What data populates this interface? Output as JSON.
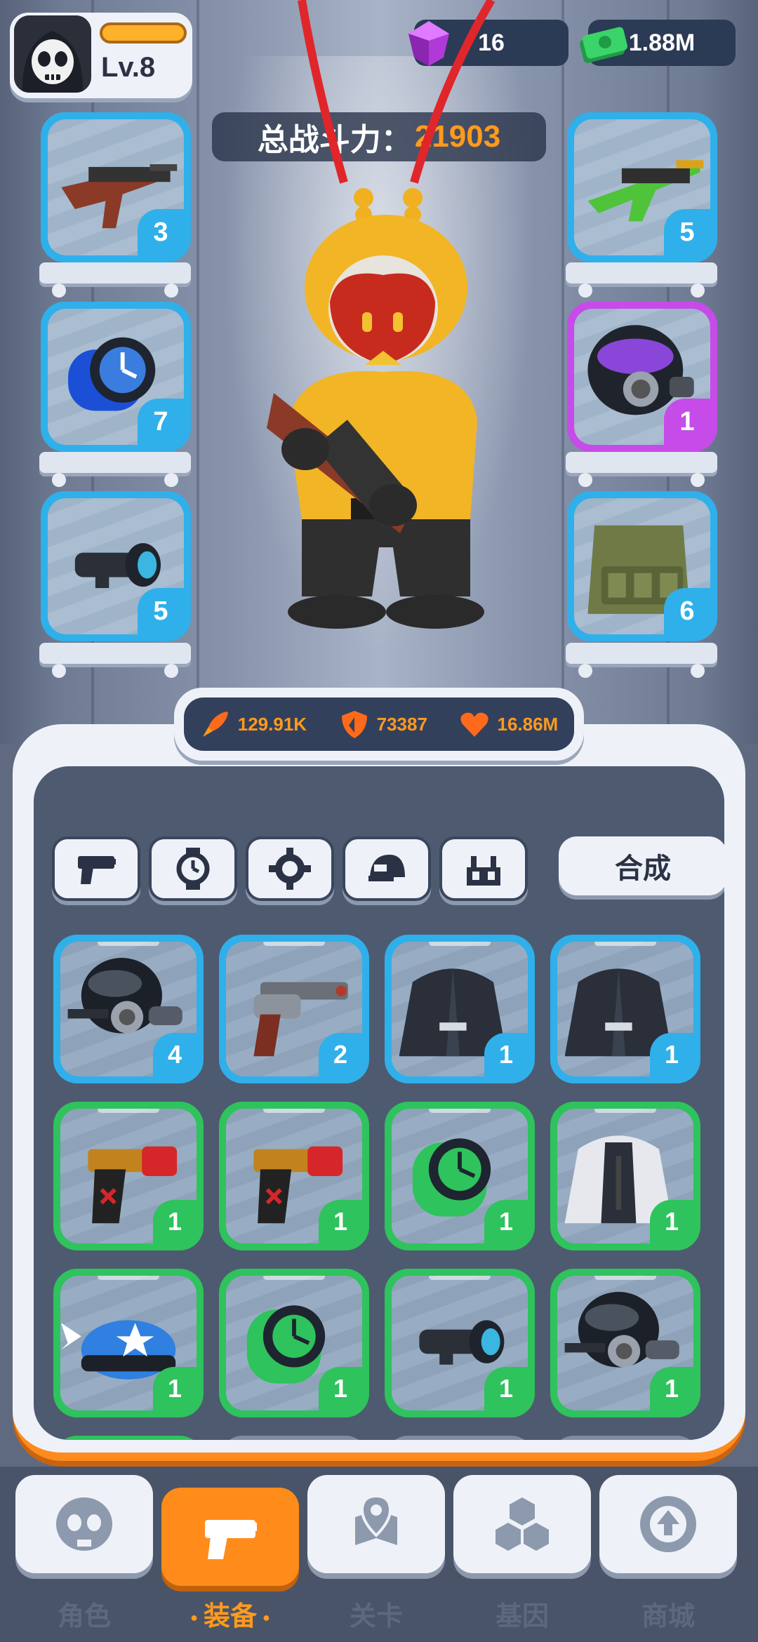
{
  "player": {
    "level": "Lv.8",
    "xp_progress": 1.0
  },
  "currency": {
    "gems": "16",
    "cash": "1.88M"
  },
  "power": {
    "label": "总战斗力：",
    "value": "21903"
  },
  "equipped": {
    "left": [
      {
        "icon": "assault-rifle-icon",
        "count": "3",
        "rarity": "blue"
      },
      {
        "icon": "blue-watch-icon",
        "count": "7",
        "rarity": "blue"
      },
      {
        "icon": "scope-icon",
        "count": "5",
        "rarity": "blue"
      }
    ],
    "right": [
      {
        "icon": "green-rifle-icon",
        "count": "5",
        "rarity": "blue"
      },
      {
        "icon": "gas-mask-helmet-icon",
        "count": "1",
        "rarity": "purple"
      },
      {
        "icon": "tactical-vest-icon",
        "count": "6",
        "rarity": "blue"
      }
    ]
  },
  "stats": {
    "attack": "129.91K",
    "defense": "73387",
    "health": "16.86M"
  },
  "categories": [
    "gun-icon",
    "watch-icon",
    "gear-icon",
    "helmet-icon",
    "armor-icon"
  ],
  "merge_label": "合成",
  "inventory": [
    {
      "icon": "gas-mask-icon",
      "count": "4",
      "rarity": "blue"
    },
    {
      "icon": "revolver-icon",
      "count": "2",
      "rarity": "blue"
    },
    {
      "icon": "black-jacket-icon",
      "count": "1",
      "rarity": "blue"
    },
    {
      "icon": "black-jacket-icon",
      "count": "1",
      "rarity": "blue"
    },
    {
      "icon": "pistol-icon",
      "count": "1",
      "rarity": "green"
    },
    {
      "icon": "pistol-icon",
      "count": "1",
      "rarity": "green"
    },
    {
      "icon": "green-watch-icon",
      "count": "1",
      "rarity": "green"
    },
    {
      "icon": "white-jacket-icon",
      "count": "1",
      "rarity": "green"
    },
    {
      "icon": "winged-cap-icon",
      "count": "1",
      "rarity": "green"
    },
    {
      "icon": "green-watch-icon",
      "count": "1",
      "rarity": "green"
    },
    {
      "icon": "scope-icon",
      "count": "1",
      "rarity": "green"
    },
    {
      "icon": "gas-mask-icon",
      "count": "1",
      "rarity": "green"
    }
  ],
  "nav": [
    {
      "label": "角色",
      "icon": "skull-icon",
      "active": false
    },
    {
      "label": "装备",
      "icon": "gun-icon",
      "active": true
    },
    {
      "label": "关卡",
      "icon": "map-pin-icon",
      "active": false
    },
    {
      "label": "基因",
      "icon": "hexagon-icon",
      "active": false
    },
    {
      "label": "商城",
      "icon": "shop-icon",
      "active": false
    }
  ],
  "colors": {
    "accent": "#ff9a1e",
    "blue_rarity": "#2fb0ea",
    "green_rarity": "#2ec35c",
    "purple_rarity": "#c64be8"
  }
}
